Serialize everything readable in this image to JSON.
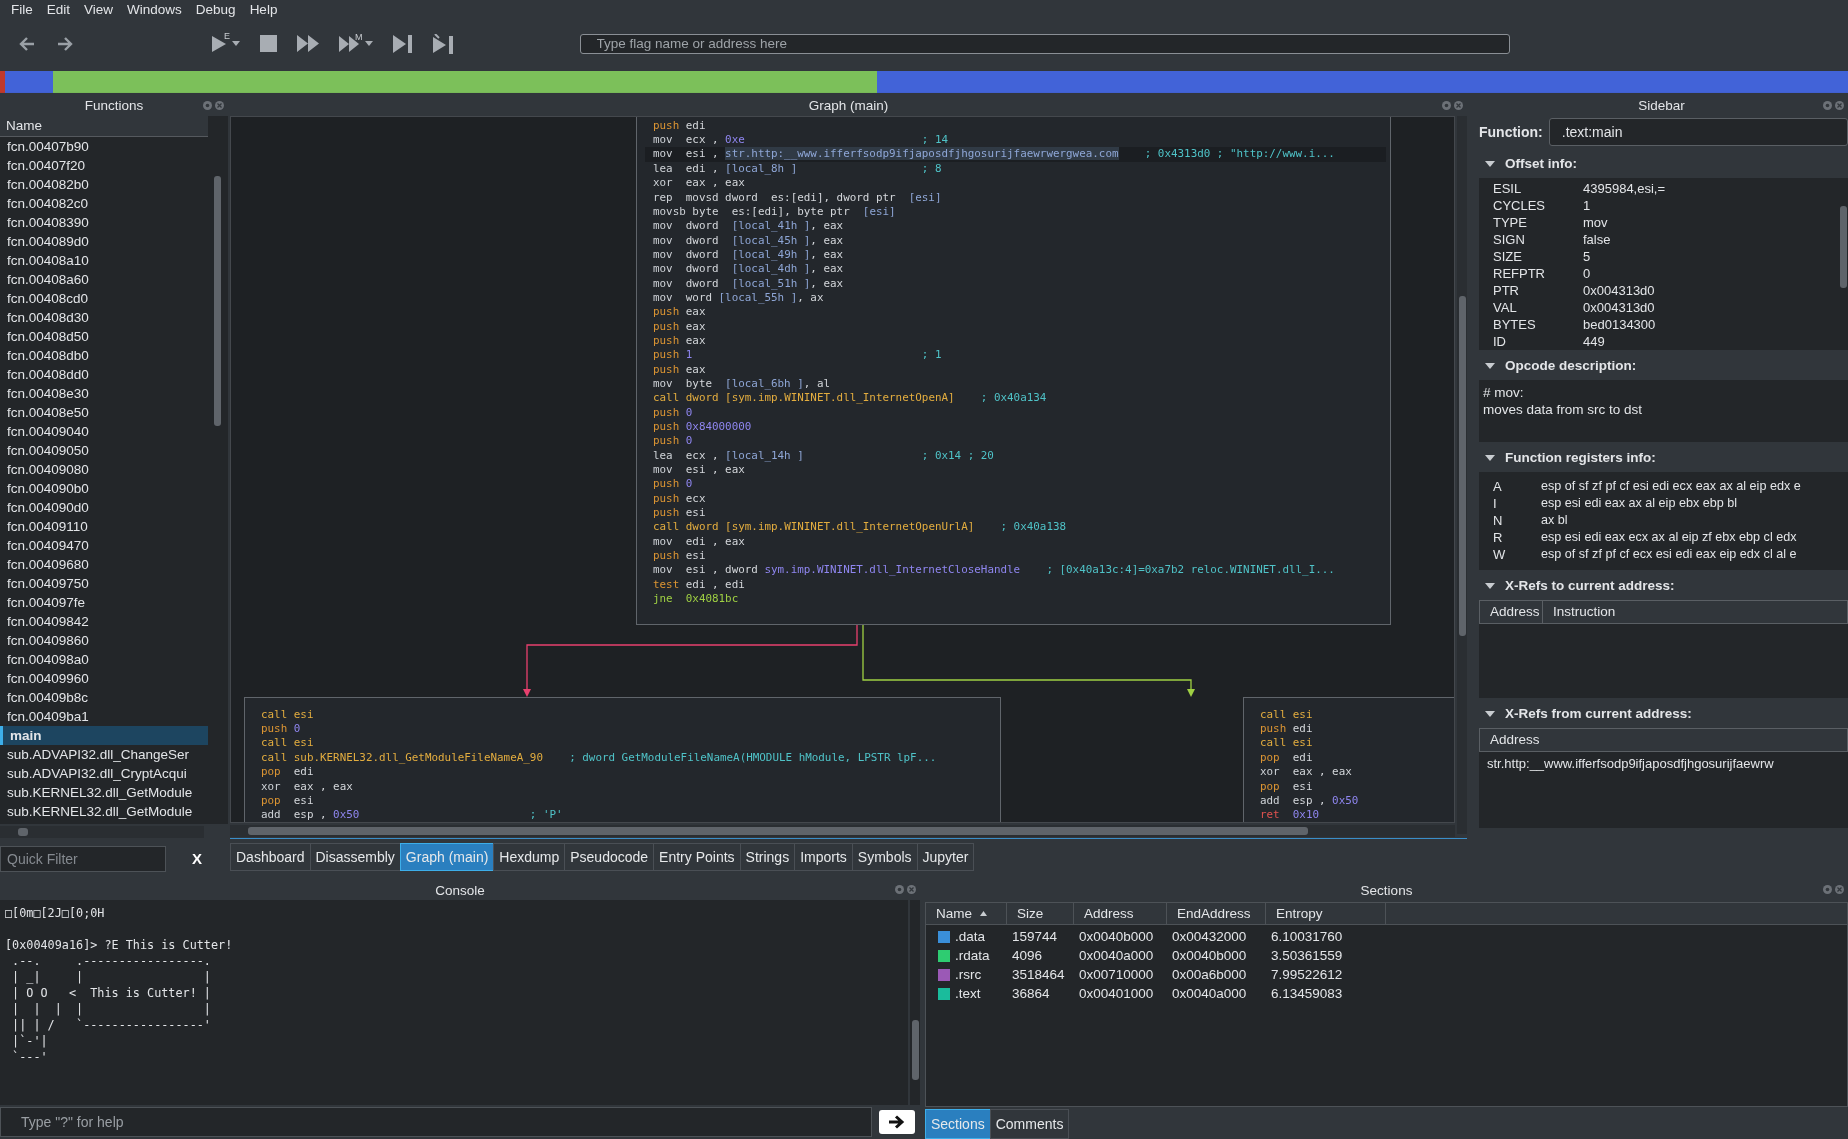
{
  "menu": [
    "File",
    "Edit",
    "View",
    "Windows",
    "Debug",
    "Help"
  ],
  "toolbar": {
    "run_badge": "E",
    "step_badge": "M",
    "search": {
      "placeholder": "Type flag name or address here"
    }
  },
  "functions": {
    "title": "Functions",
    "column": "Name",
    "items": [
      {
        "name": "fcn.00407b90",
        "selected": false
      },
      {
        "name": "fcn.00407f20",
        "selected": false
      },
      {
        "name": "fcn.004082b0",
        "selected": false
      },
      {
        "name": "fcn.004082c0",
        "selected": false
      },
      {
        "name": "fcn.00408390",
        "selected": false
      },
      {
        "name": "fcn.004089d0",
        "selected": false
      },
      {
        "name": "fcn.00408a10",
        "selected": false
      },
      {
        "name": "fcn.00408a60",
        "selected": false
      },
      {
        "name": "fcn.00408cd0",
        "selected": false
      },
      {
        "name": "fcn.00408d30",
        "selected": false
      },
      {
        "name": "fcn.00408d50",
        "selected": false
      },
      {
        "name": "fcn.00408db0",
        "selected": false
      },
      {
        "name": "fcn.00408dd0",
        "selected": false
      },
      {
        "name": "fcn.00408e30",
        "selected": false
      },
      {
        "name": "fcn.00408e50",
        "selected": false
      },
      {
        "name": "fcn.00409040",
        "selected": false
      },
      {
        "name": "fcn.00409050",
        "selected": false
      },
      {
        "name": "fcn.00409080",
        "selected": false
      },
      {
        "name": "fcn.004090b0",
        "selected": false
      },
      {
        "name": "fcn.004090d0",
        "selected": false
      },
      {
        "name": "fcn.00409110",
        "selected": false
      },
      {
        "name": "fcn.00409470",
        "selected": false
      },
      {
        "name": "fcn.00409680",
        "selected": false
      },
      {
        "name": "fcn.00409750",
        "selected": false
      },
      {
        "name": "fcn.004097fe",
        "selected": false
      },
      {
        "name": "fcn.00409842",
        "selected": false
      },
      {
        "name": "fcn.00409860",
        "selected": false
      },
      {
        "name": "fcn.004098a0",
        "selected": false
      },
      {
        "name": "fcn.00409960",
        "selected": false
      },
      {
        "name": "fcn.00409b8c",
        "selected": false
      },
      {
        "name": "fcn.00409ba1",
        "selected": false
      },
      {
        "name": "main",
        "selected": true
      },
      {
        "name": "sub.ADVAPI32.dll_ChangeSer",
        "selected": false
      },
      {
        "name": "sub.ADVAPI32.dll_CryptAcqui",
        "selected": false
      },
      {
        "name": "sub.KERNEL32.dll_GetModule",
        "selected": false
      },
      {
        "name": "sub.KERNEL32.dll_GetModule",
        "selected": false
      }
    ],
    "filter": {
      "placeholder": "Quick Filter"
    },
    "clear": "X"
  },
  "graph": {
    "title": "Graph (main)",
    "blocks": [
      {
        "lines": [
          {
            "op": "push",
            "kind": "stack",
            "operands": [
              {
                "text": "edi",
                "kind": "reg"
              }
            ],
            "selected": false
          },
          {
            "op": "mov",
            "kind": "move",
            "operands": [
              {
                "text": "ecx , ",
                "kind": "reg"
              },
              {
                "text": "0xe",
                "kind": "num"
              }
            ],
            "comment": "; 14",
            "selected": false
          },
          {
            "op": "mov",
            "kind": "move",
            "operands": [
              {
                "text": "esi , ",
                "kind": "reg"
              },
              {
                "text": "str.http:__www.ifferfsodp9ifjaposdfjhgosurijfaewrwergwea.com",
                "kind": "string"
              }
            ],
            "comment": "; 0x4313d0 ; \"http://www.i...",
            "selected": true
          },
          {
            "op": "lea",
            "kind": "move",
            "operands": [
              {
                "text": "edi , ",
                "kind": "reg"
              },
              {
                "text": "[local_8h ]",
                "kind": "mem"
              }
            ],
            "comment": "; 8",
            "selected": false
          },
          {
            "op": "xor",
            "kind": "move",
            "operands": [
              {
                "text": "eax , eax",
                "kind": "reg"
              }
            ],
            "selected": false
          },
          {
            "op": "rep",
            "kind": "move",
            "operands": [
              {
                "text": "movsd dword  es:[edi], dword ptr  ",
                "kind": "reg"
              },
              {
                "text": "[esi]",
                "kind": "mem"
              }
            ],
            "selected": false
          },
          {
            "op": "movsb",
            "kind": "move",
            "operands": [
              {
                "text": "byte  es:[edi], byte ptr  ",
                "kind": "reg"
              },
              {
                "text": "[esi]",
                "kind": "mem"
              }
            ],
            "selected": false
          },
          {
            "op": "mov",
            "kind": "move",
            "operands": [
              {
                "text": "dword  ",
                "kind": "reg"
              },
              {
                "text": "[local_41h ]",
                "kind": "mem"
              },
              {
                "text": ", eax",
                "kind": "reg"
              }
            ],
            "selected": false
          },
          {
            "op": "mov",
            "kind": "move",
            "operands": [
              {
                "text": "dword  ",
                "kind": "reg"
              },
              {
                "text": "[local_45h ]",
                "kind": "mem"
              },
              {
                "text": ", eax",
                "kind": "reg"
              }
            ],
            "selected": false
          },
          {
            "op": "mov",
            "kind": "move",
            "operands": [
              {
                "text": "dword  ",
                "kind": "reg"
              },
              {
                "text": "[local_49h ]",
                "kind": "mem"
              },
              {
                "text": ", eax",
                "kind": "reg"
              }
            ],
            "selected": false
          },
          {
            "op": "mov",
            "kind": "move",
            "operands": [
              {
                "text": "dword  ",
                "kind": "reg"
              },
              {
                "text": "[local_4dh ]",
                "kind": "mem"
              },
              {
                "text": ", eax",
                "kind": "reg"
              }
            ],
            "selected": false
          },
          {
            "op": "mov",
            "kind": "move",
            "operands": [
              {
                "text": "dword  ",
                "kind": "reg"
              },
              {
                "text": "[local_51h ]",
                "kind": "mem"
              },
              {
                "text": ", eax",
                "kind": "reg"
              }
            ],
            "selected": false
          },
          {
            "op": "mov",
            "kind": "move",
            "operands": [
              {
                "text": "word ",
                "kind": "reg"
              },
              {
                "text": "[local_55h ]",
                "kind": "mem"
              },
              {
                "text": ", ax",
                "kind": "reg"
              }
            ],
            "selected": false
          },
          {
            "op": "push",
            "kind": "stack",
            "operands": [
              {
                "text": "eax",
                "kind": "reg"
              }
            ],
            "selected": false
          },
          {
            "op": "push",
            "kind": "stack",
            "operands": [
              {
                "text": "eax",
                "kind": "reg"
              }
            ],
            "selected": false
          },
          {
            "op": "push",
            "kind": "stack",
            "operands": [
              {
                "text": "eax",
                "kind": "reg"
              }
            ],
            "selected": false
          },
          {
            "op": "push",
            "kind": "stack",
            "operands": [
              {
                "text": "1",
                "kind": "num"
              }
            ],
            "comment": "; 1",
            "selected": false
          },
          {
            "op": "push",
            "kind": "stack",
            "operands": [
              {
                "text": "eax",
                "kind": "reg"
              }
            ],
            "selected": false
          },
          {
            "op": "mov",
            "kind": "move",
            "operands": [
              {
                "text": "byte  ",
                "kind": "reg"
              },
              {
                "text": "[local_6bh ]",
                "kind": "mem"
              },
              {
                "text": ", al",
                "kind": "reg"
              }
            ],
            "selected": false
          },
          {
            "op": "call",
            "kind": "call",
            "operands": [
              {
                "text": "dword [sym.imp.WININET.dll_InternetOpenA]",
                "kind": "target"
              }
            ],
            "comment": "; 0x40a134",
            "selected": false
          },
          {
            "op": "push",
            "kind": "stack",
            "operands": [
              {
                "text": "0",
                "kind": "num"
              }
            ],
            "selected": false
          },
          {
            "op": "push",
            "kind": "stack",
            "operands": [
              {
                "text": "0x84000000",
                "kind": "num"
              }
            ],
            "selected": false
          },
          {
            "op": "push",
            "kind": "stack",
            "operands": [
              {
                "text": "0",
                "kind": "num"
              }
            ],
            "selected": false
          },
          {
            "op": "lea",
            "kind": "move",
            "operands": [
              {
                "text": "ecx , ",
                "kind": "reg"
              },
              {
                "text": "[local_14h ]",
                "kind": "mem"
              }
            ],
            "comment": "; 0x14 ; 20",
            "selected": false
          },
          {
            "op": "mov",
            "kind": "move",
            "operands": [
              {
                "text": "esi , eax",
                "kind": "reg"
              }
            ],
            "selected": false
          },
          {
            "op": "push",
            "kind": "stack",
            "operands": [
              {
                "text": "0",
                "kind": "num"
              }
            ],
            "selected": false
          },
          {
            "op": "push",
            "kind": "stack",
            "operands": [
              {
                "text": "ecx",
                "kind": "reg"
              }
            ],
            "selected": false
          },
          {
            "op": "push",
            "kind": "stack",
            "operands": [
              {
                "text": "esi",
                "kind": "reg"
              }
            ],
            "selected": false
          },
          {
            "op": "call",
            "kind": "call",
            "operands": [
              {
                "text": "dword [sym.imp.WININET.dll_InternetOpenUrlA]",
                "kind": "target"
              }
            ],
            "comment": "; 0x40a138",
            "selected": false
          },
          {
            "op": "mov",
            "kind": "move",
            "operands": [
              {
                "text": "edi , eax",
                "kind": "reg"
              }
            ],
            "selected": false
          },
          {
            "op": "push",
            "kind": "stack",
            "operands": [
              {
                "text": "esi",
                "kind": "reg"
              }
            ],
            "selected": false
          },
          {
            "op": "mov",
            "kind": "move",
            "operands": [
              {
                "text": "esi , dword ",
                "kind": "reg"
              },
              {
                "text": "sym.imp.WININET.dll_InternetCloseHandle",
                "kind": "num"
              }
            ],
            "comment": "; [0x40a13c:4]=0xa7b2 reloc.WININET.dll_I...",
            "selected": false
          },
          {
            "op": "test",
            "kind": "stack",
            "operands": [
              {
                "text": "edi , edi",
                "kind": "reg"
              }
            ],
            "selected": false
          },
          {
            "op": "jne",
            "kind": "jump",
            "operands": [
              {
                "text": "0x4081bc",
                "kind": "target"
              }
            ],
            "selected": false
          }
        ]
      },
      {
        "lines": [
          {
            "op": "call",
            "kind": "call",
            "operands": [
              {
                "text": "esi",
                "kind": "target"
              }
            ],
            "selected": false
          },
          {
            "op": "push",
            "kind": "stack",
            "operands": [
              {
                "text": "0",
                "kind": "num"
              }
            ],
            "selected": false
          },
          {
            "op": "call",
            "kind": "call",
            "operands": [
              {
                "text": "esi",
                "kind": "target"
              }
            ],
            "selected": false
          },
          {
            "op": "call",
            "kind": "call",
            "operands": [
              {
                "text": "sub.KERNEL32.dll_GetModuleFileNameA_90",
                "kind": "target"
              }
            ],
            "comment": "; dword GetModuleFileNameA(HMODULE hModule, LPSTR lpF...",
            "selected": false
          },
          {
            "op": "pop",
            "kind": "stack",
            "operands": [
              {
                "text": "edi",
                "kind": "reg"
              }
            ],
            "selected": false
          },
          {
            "op": "xor",
            "kind": "move",
            "operands": [
              {
                "text": "eax , eax",
                "kind": "reg"
              }
            ],
            "selected": false
          },
          {
            "op": "pop",
            "kind": "stack",
            "operands": [
              {
                "text": "esi",
                "kind": "reg"
              }
            ],
            "selected": false
          },
          {
            "op": "add",
            "kind": "move",
            "operands": [
              {
                "text": "esp , ",
                "kind": "reg"
              },
              {
                "text": "0x50",
                "kind": "num"
              }
            ],
            "comment": "; 'P'",
            "selected": false
          }
        ]
      },
      {
        "lines": [
          {
            "op": "call",
            "kind": "call",
            "operands": [
              {
                "text": "esi",
                "kind": "target"
              }
            ],
            "selected": false
          },
          {
            "op": "push",
            "kind": "stack",
            "operands": [
              {
                "text": "edi",
                "kind": "reg"
              }
            ],
            "selected": false
          },
          {
            "op": "call",
            "kind": "call",
            "operands": [
              {
                "text": "esi",
                "kind": "target"
              }
            ],
            "selected": false
          },
          {
            "op": "pop",
            "kind": "stack",
            "operands": [
              {
                "text": "edi",
                "kind": "reg"
              }
            ],
            "selected": false
          },
          {
            "op": "xor",
            "kind": "move",
            "operands": [
              {
                "text": "eax , eax",
                "kind": "reg"
              }
            ],
            "selected": false
          },
          {
            "op": "pop",
            "kind": "stack",
            "operands": [
              {
                "text": "esi",
                "kind": "reg"
              }
            ],
            "selected": false
          },
          {
            "op": "add",
            "kind": "move",
            "operands": [
              {
                "text": "esp , ",
                "kind": "reg"
              },
              {
                "text": "0x50",
                "kind": "num"
              }
            ],
            "selected": false
          },
          {
            "op": "ret",
            "kind": "ret",
            "operands": [
              {
                "text": "0x10",
                "kind": "num"
              }
            ],
            "selected": false
          }
        ]
      }
    ]
  },
  "tabs": [
    {
      "label": "Dashboard",
      "selected": false
    },
    {
      "label": "Disassembly",
      "selected": false
    },
    {
      "label": "Graph (main)",
      "selected": true
    },
    {
      "label": "Hexdump",
      "selected": false
    },
    {
      "label": "Pseudocode",
      "selected": false
    },
    {
      "label": "Entry Points",
      "selected": false
    },
    {
      "label": "Strings",
      "selected": false
    },
    {
      "label": "Imports",
      "selected": false
    },
    {
      "label": "Symbols",
      "selected": false
    },
    {
      "label": "Jupyter",
      "selected": false
    }
  ],
  "sidebar": {
    "title": "Sidebar",
    "function_label": "Function:",
    "function_value": ".text:main",
    "offset_info": {
      "title": "Offset info:",
      "expanded": true,
      "rows": [
        {
          "key": "ESIL",
          "value": "4395984,esi,="
        },
        {
          "key": "CYCLES",
          "value": "1"
        },
        {
          "key": "TYPE",
          "value": "mov"
        },
        {
          "key": "SIGN",
          "value": "false"
        },
        {
          "key": "SIZE",
          "value": "5"
        },
        {
          "key": "REFPTR",
          "value": "0"
        },
        {
          "key": "PTR",
          "value": "0x004313d0"
        },
        {
          "key": "VAL",
          "value": "0x004313d0"
        },
        {
          "key": "BYTES",
          "value": "bed0134300"
        },
        {
          "key": "ID",
          "value": "449"
        }
      ]
    },
    "opcode": {
      "title": "Opcode description:",
      "expanded": true,
      "lines": [
        "# mov:",
        "moves data from src to dst"
      ]
    },
    "registers": {
      "title": "Function registers info:",
      "expanded": true,
      "rows": [
        {
          "key": "A",
          "value": "esp of sf zf pf cf esi edi ecx eax ax al eip edx e"
        },
        {
          "key": "I",
          "value": "esp esi edi eax ax al eip ebx ebp bl"
        },
        {
          "key": "N",
          "value": "ax bl"
        },
        {
          "key": "R",
          "value": "esp esi edi eax ecx ax al eip zf ebx ebp cl edx"
        },
        {
          "key": "W",
          "value": "esp of sf zf pf cf ecx esi edi eax eip edx cl al e"
        }
      ]
    },
    "xrefs_to": {
      "title": "X-Refs to current address:",
      "expanded": true,
      "columns": [
        "Address",
        "Instruction"
      ]
    },
    "xrefs_from": {
      "title": "X-Refs from current address:",
      "expanded": true,
      "columns": [
        "Address"
      ],
      "rows": [
        "str.http:__www.ifferfsodp9ifjaposdfjhgosurijfaewrw"
      ]
    }
  },
  "console": {
    "title": "Console",
    "lines": [
      "□[0m□[2J□[0;0H",
      "[0x00409a16]> ?E This is Cutter!",
      " .--.     .-----------------.",
      " | _|     |                 |",
      " | O O   <  This is Cutter! |",
      " |  |  |  |                 |",
      " || | /   `-----------------'",
      " |`-'|",
      " `---'"
    ],
    "input": {
      "placeholder": "Type \"?\" for help"
    }
  },
  "sections": {
    "title": "Sections",
    "columns": [
      "Name",
      "Size",
      "Address",
      "EndAddress",
      "Entropy"
    ],
    "rows": [
      {
        "name": ".data",
        "color": "#3a8fd9",
        "size": "159744",
        "address": "0x0040b000",
        "end": "0x00432000",
        "entropy": "6.10031760"
      },
      {
        "name": ".rdata",
        "color": "#2ecc71",
        "size": "4096",
        "address": "0x0040a000",
        "end": "0x0040b000",
        "entropy": "3.50361559"
      },
      {
        "name": ".rsrc",
        "color": "#9b59b6",
        "size": "3518464",
        "address": "0x00710000",
        "end": "0x00a6b000",
        "entropy": "7.99522612"
      },
      {
        "name": ".text",
        "color": "#1abc9c",
        "size": "36864",
        "address": "0x00401000",
        "end": "0x0040a000",
        "entropy": "6.13459083"
      }
    ],
    "tabs": [
      {
        "label": "Sections",
        "selected": true
      },
      {
        "label": "Comments",
        "selected": false
      }
    ]
  }
}
